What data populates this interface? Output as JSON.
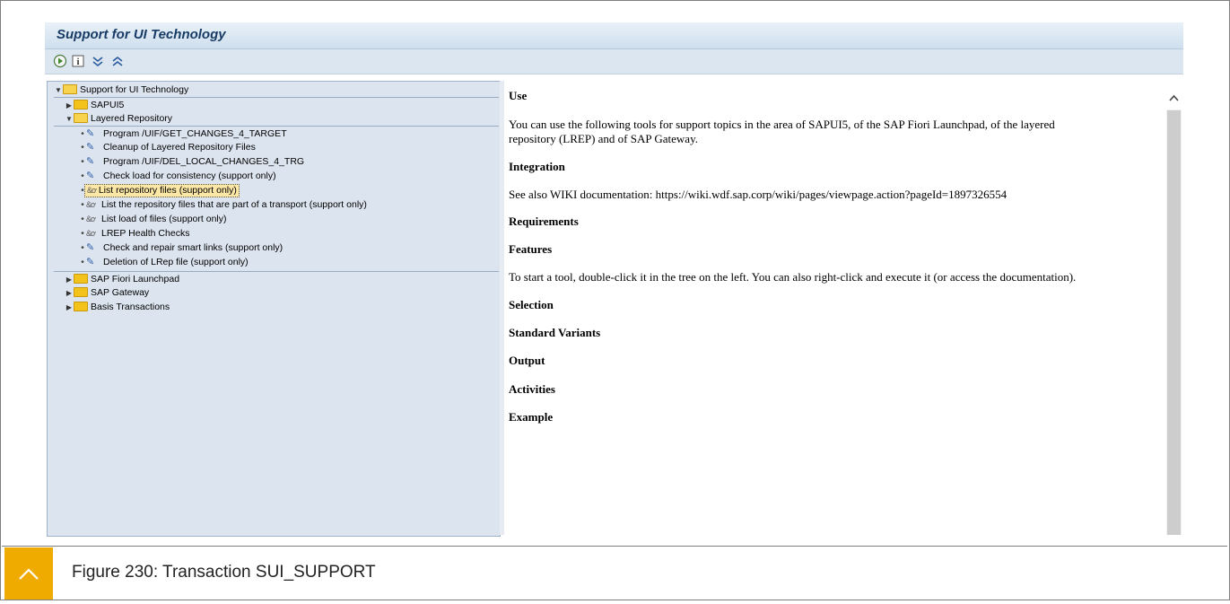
{
  "window": {
    "title": "Support for UI Technology"
  },
  "toolbar": {
    "buttons": [
      {
        "icon": "execute-icon"
      },
      {
        "icon": "info-icon"
      },
      {
        "icon": "expand-all-icon"
      },
      {
        "icon": "collapse-all-icon"
      }
    ]
  },
  "tree": {
    "root": "Support for UI Technology",
    "sapui5": "SAPUI5",
    "layered_repository": "Layered Repository",
    "lrep_items": [
      "Program /UIF/GET_CHANGES_4_TARGET",
      "Cleanup of Layered Repository Files",
      "Program /UIF/DEL_LOCAL_CHANGES_4_TRG",
      "Check load for consistency (support only)",
      "List repository files (support only)",
      "List the repository files that are part of a transport (support only)",
      "List load of files (support only)",
      "LREP Health Checks",
      "Check and repair smart links (support only)",
      "Deletion of LRep file (support only)"
    ],
    "fiori_launchpad": "SAP Fiori Launchpad",
    "gateway": "SAP Gateway",
    "basis": "Basis Transactions"
  },
  "documentation": {
    "use_heading": "Use",
    "use_text_line1": "You can use the following tools for support topics in the area of SAPUI5, of the SAP Fiori Launchpad, of the layered",
    "use_text_line2": "repository (LREP) and of SAP Gateway.",
    "integration_heading": "Integration",
    "integration_text": "See also WIKI documentation: https://wiki.wdf.sap.corp/wiki/pages/viewpage.action?pageId=1897326554",
    "requirements_heading": "Requirements",
    "features_heading": "Features",
    "features_text": "To start a tool, double-click it in the tree on the left. You can also right-click and execute it (or access the documentation).",
    "selection_heading": "Selection",
    "standard_variants_heading": "Standard Variants",
    "output_heading": "Output",
    "activities_heading": "Activities",
    "example_heading": "Example"
  },
  "caption": {
    "text": "Figure 230: Transaction SUI_SUPPORT"
  },
  "colors": {
    "accent": "#f0ab00",
    "title": "#183c66",
    "selection": "#fbe7a6"
  }
}
